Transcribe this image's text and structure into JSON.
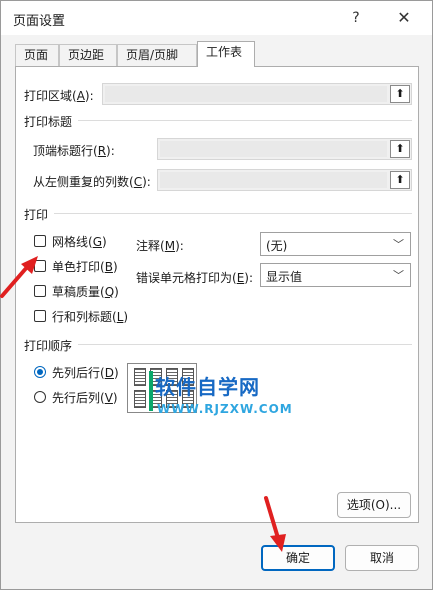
{
  "window": {
    "title": "页面设置",
    "help": "?",
    "close": "✕"
  },
  "tabs": [
    {
      "label": "页面",
      "active": false
    },
    {
      "label": "页边距",
      "active": false
    },
    {
      "label": "页眉/页脚",
      "active": false
    },
    {
      "label": "工作表",
      "active": true
    }
  ],
  "print_area": {
    "label": "打印区域",
    "key": "A",
    "value": ""
  },
  "print_titles": {
    "heading": "打印标题",
    "rows_label": "顶端标题行",
    "rows_key": "R",
    "cols_label": "从左侧重复的列数",
    "cols_key": "C"
  },
  "print": {
    "heading": "打印",
    "gridlines": {
      "label": "网格线",
      "key": "G",
      "checked": false
    },
    "bw": {
      "label": "单色打印",
      "key": "B",
      "checked": false
    },
    "draft": {
      "label": "草稿质量",
      "key": "Q",
      "checked": false
    },
    "headings": {
      "label": "行和列标题",
      "key": "L",
      "checked": false
    },
    "comments_label": "注释",
    "comments_key": "M",
    "comments_value": "(无)",
    "errors_label": "错误单元格打印为",
    "errors_key": "E",
    "errors_value": "显示值"
  },
  "order": {
    "heading": "打印顺序",
    "down_then_over": {
      "label": "先列后行",
      "key": "D",
      "selected": true
    },
    "over_then_down": {
      "label": "先行后列",
      "key": "V",
      "selected": false
    }
  },
  "watermark": {
    "title": "软件自学网",
    "url": "WWW.RJZXW.COM"
  },
  "buttons": {
    "options": "选项(O)...",
    "ok": "确定",
    "cancel": "取消"
  },
  "colors": {
    "accent": "#0067c0",
    "arrow": "#e02020"
  }
}
